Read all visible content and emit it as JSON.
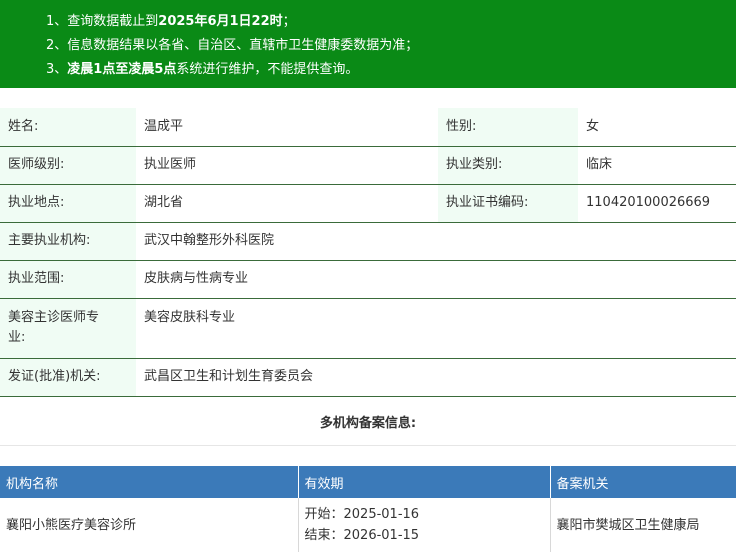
{
  "notice": {
    "line1_prefix": "1、查询数据截止到",
    "line1_bold": "2025年6月1日22时",
    "line1_suffix": "；",
    "line2": "2、信息数据结果以各省、自治区、直辖市卫生健康委数据为准；",
    "line3_prefix": "3、",
    "line3_bold": "凌晨1点至凌晨5点",
    "line3_suffix": "系统进行维护，不能提供查询。"
  },
  "info": {
    "name_label": "姓名:",
    "name_value": "温成平",
    "gender_label": "性别:",
    "gender_value": "女",
    "level_label": "医师级别:",
    "level_value": "执业医师",
    "category_label": "执业类别:",
    "category_value": "临床",
    "location_label": "执业地点:",
    "location_value": "湖北省",
    "cert_label": "执业证书编码:",
    "cert_value": "110420100026669",
    "org_label": "主要执业机构:",
    "org_value": "武汉中翰整形外科医院",
    "scope_label": "执业范围:",
    "scope_value": "皮肤病与性病专业",
    "cosmetic_label_1": "美容主诊医师专",
    "cosmetic_label_2": "业:",
    "cosmetic_value": "美容皮肤科专业",
    "issuer_label": "发证(批准)机关:",
    "issuer_value": "武昌区卫生和计划生育委员会"
  },
  "multi_title": "多机构备案信息:",
  "org_table": {
    "headers": [
      "机构名称",
      "有效期",
      "备案机关"
    ],
    "rows": [
      {
        "name": "襄阳小熊医疗美容诊所",
        "start": "开始：2025-01-16",
        "end": "结束：2026-01-15",
        "authority": "襄阳市樊城区卫生健康局"
      }
    ]
  },
  "colors": {
    "notice_bg": "#0a8a16",
    "header_bg": "#3b7ab9",
    "label_bg": "#f0fcf4"
  }
}
